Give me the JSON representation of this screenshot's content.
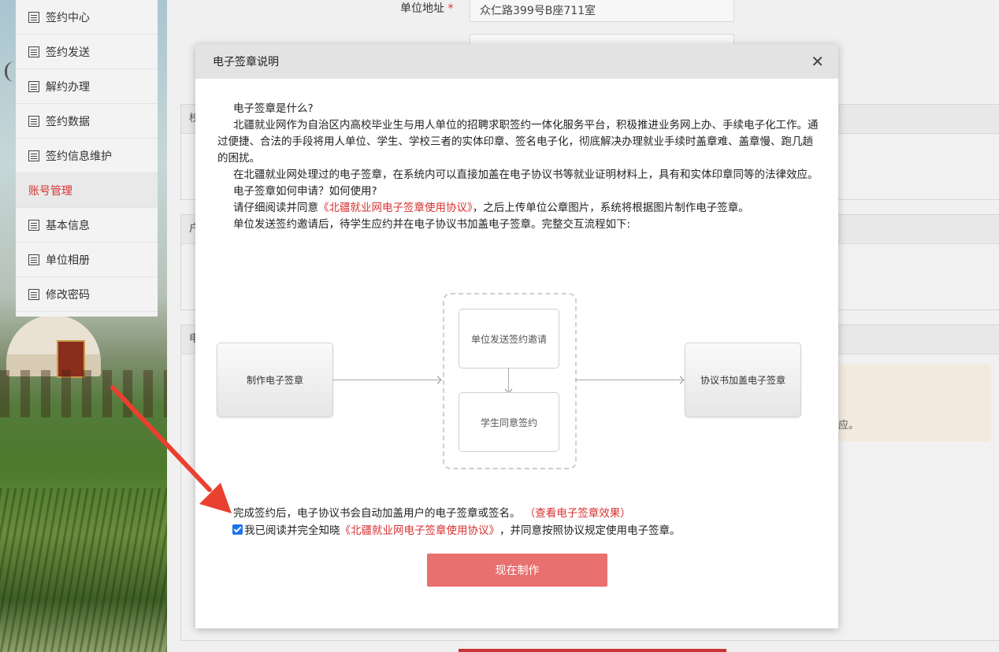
{
  "sidebar": {
    "items": [
      {
        "label": "签约中心",
        "icon": "list-icon"
      },
      {
        "label": "签约发送",
        "icon": "list-icon"
      },
      {
        "label": "解约办理",
        "icon": "list-icon"
      },
      {
        "label": "签约数据",
        "icon": "list-icon"
      },
      {
        "label": "签约信息维护",
        "icon": "document-icon"
      }
    ],
    "group_label": "账号管理",
    "account_items": [
      {
        "label": "基本信息",
        "icon": "list-icon"
      },
      {
        "label": "单位相册",
        "icon": "list-icon"
      },
      {
        "label": "修改密码",
        "icon": "list-icon"
      }
    ]
  },
  "form": {
    "address_label": "单位地址",
    "required_mark": "*",
    "address_value": "众仁路399号B座711室"
  },
  "panels": {
    "panel1_head": "校",
    "panel2_head": "户",
    "panel3_head": "电"
  },
  "notice_tail": "应。",
  "modal": {
    "title": "电子签章说明",
    "close_symbol": "✕",
    "p1": "电子签章是什么?",
    "p2": "北疆就业网作为自治区内高校毕业生与用人单位的招聘求职签约一体化服务平台，积极推进业务网上办、手续电子化工作。通过便捷、合法的手段将用人单位、学生、学校三者的实体印章、签名电子化，彻底解决办理就业手续时盖章难、盖章慢、跑几趟的困扰。",
    "p3": "在北疆就业网处理过的电子签章，在系统内可以直接加盖在电子协议书等就业证明材料上，具有和实体印章同等的法律效应。",
    "p4": "电子签章如何申请？如何使用?",
    "p5_pre": "请仔细阅读并同意",
    "p5_link": "《北疆就业网电子签章使用协议》",
    "p5_post": "，之后上传单位公章图片，系统将根据图片制作电子签章。",
    "p6": "单位发送签约邀请后，待学生应约并在电子协议书加盖电子签章。完整交互流程如下:",
    "flow": {
      "step1": "制作电子签章",
      "step2a": "单位发送签约邀请",
      "step2b": "学生同意签约",
      "step3": "协议书加盖电子签章"
    },
    "after_text": "完成签约后，电子协议书会自动加盖用户的电子签章或签名。",
    "view_effect_link": "（查看电子签章效果）",
    "agree_pre": "我已阅读并完全知晓",
    "agree_link": "《北疆就业网电子签章使用协议》",
    "agree_post": "，并同意按照协议规定使用电子签章。",
    "agree_checked": true,
    "make_button": "现在制作"
  },
  "colors": {
    "accent_red": "#d73232",
    "button_red": "#e8706e",
    "checkbox_blue": "#1a73e8",
    "annotation_arrow": "#e8412f"
  }
}
